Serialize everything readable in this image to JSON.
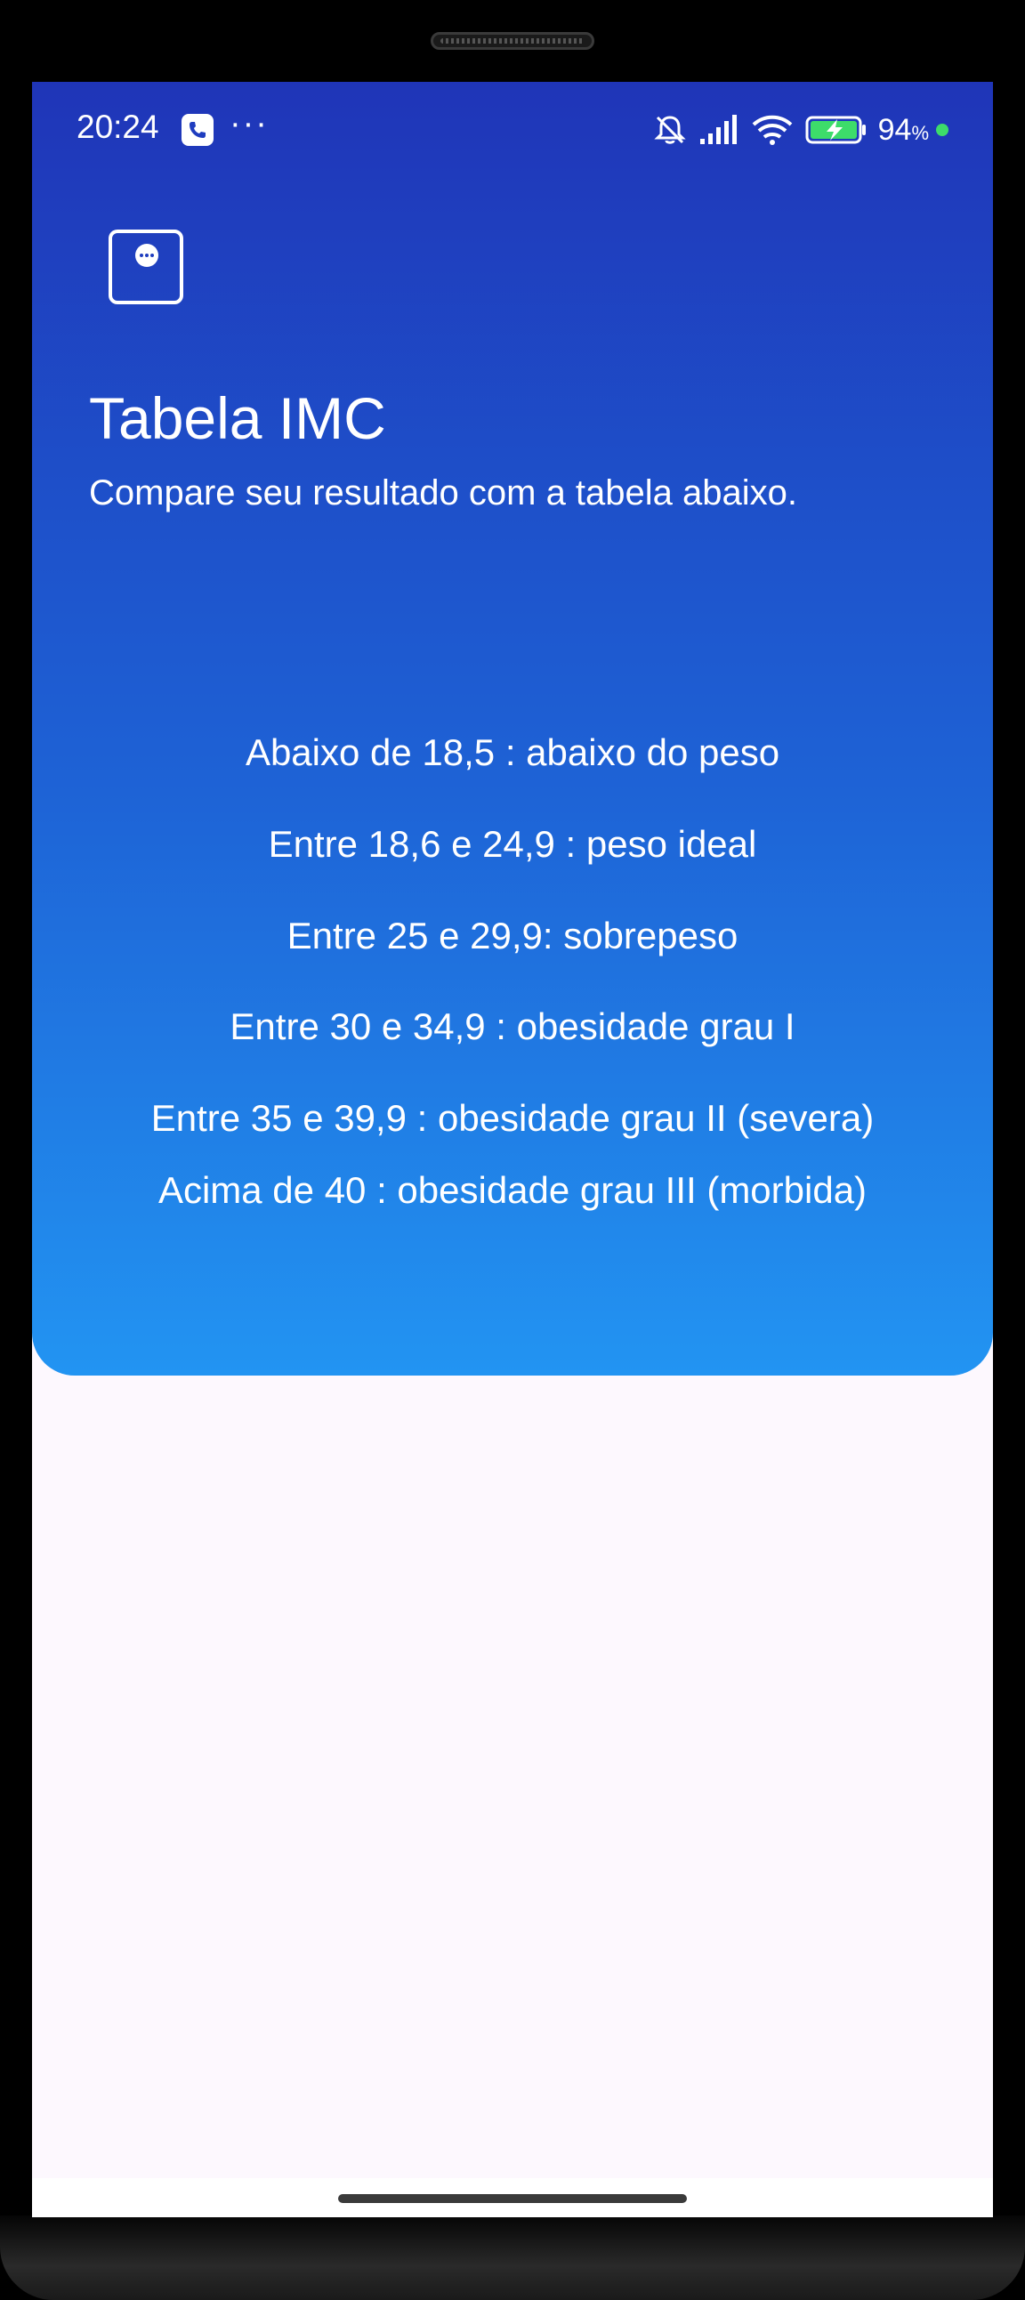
{
  "status_bar": {
    "time": "20:24",
    "more": "···",
    "battery_percent": "94",
    "battery_unit": "%",
    "icons": [
      "phone-call-icon",
      "bell-muted-icon",
      "signal-icon",
      "wifi-icon",
      "battery-charging-icon"
    ],
    "dot_color": "#3ddc6a"
  },
  "header": {
    "title": "Tabela IMC",
    "subtitle": "Compare seu resultado com a tabela abaixo.",
    "gradient": [
      "#1f35b8",
      "#2294f2"
    ]
  },
  "imc_table": [
    "Abaixo de 18,5 : abaixo do peso",
    "Entre 18,6 e 24,9 : peso ideal",
    "Entre 25 e 29,9: sobrepeso",
    "Entre 30 e 34,9 : obesidade grau I",
    "Entre 35 e 39,9 : obesidade grau II (severa)",
    "Acima de 40 : obesidade grau III (morbida)"
  ]
}
